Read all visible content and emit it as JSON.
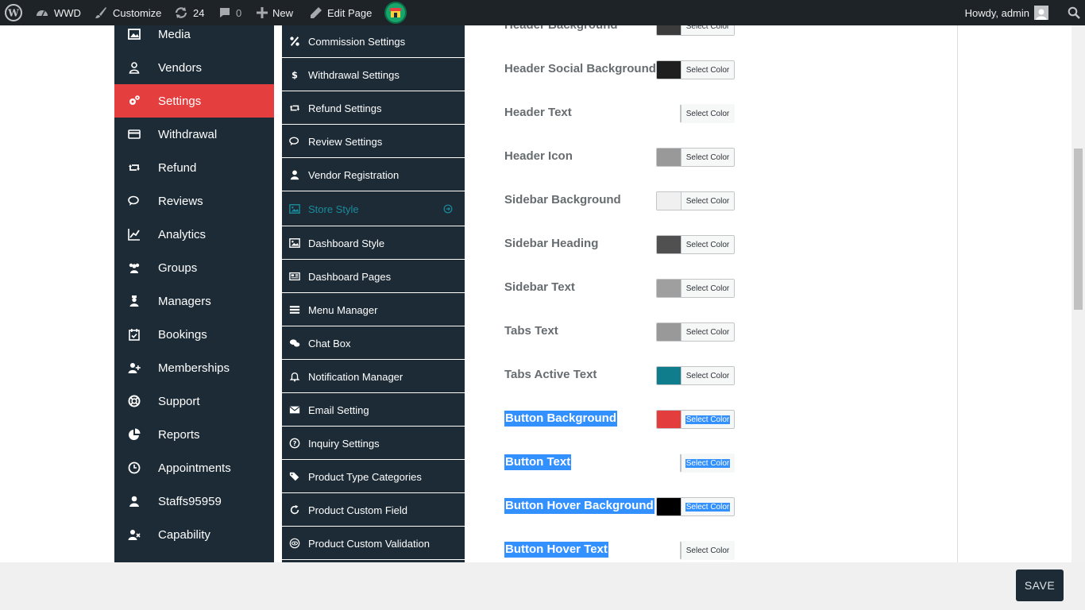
{
  "adminbar": {
    "site_name": "WWD",
    "customize": "Customize",
    "updates_count": "24",
    "comments_count": "0",
    "new_label": "New",
    "edit_page": "Edit Page",
    "howdy": "Howdy, admin"
  },
  "main_menu": [
    {
      "label": "Media",
      "icon": "media-icon"
    },
    {
      "label": "Vendors",
      "icon": "vendor-user-icon"
    },
    {
      "label": "Settings",
      "icon": "cogs-icon",
      "active": true
    },
    {
      "label": "Withdrawal",
      "icon": "credit-card-icon"
    },
    {
      "label": "Refund",
      "icon": "retweet-icon"
    },
    {
      "label": "Reviews",
      "icon": "comments-icon"
    },
    {
      "label": "Analytics",
      "icon": "chart-line-icon"
    },
    {
      "label": "Groups",
      "icon": "users-icon"
    },
    {
      "label": "Managers",
      "icon": "manager-icon"
    },
    {
      "label": "Bookings",
      "icon": "calendar-check-icon"
    },
    {
      "label": "Memberships",
      "icon": "user-plus-icon"
    },
    {
      "label": "Support",
      "icon": "life-ring-icon"
    },
    {
      "label": "Reports",
      "icon": "pie-chart-icon"
    },
    {
      "label": "Appointments",
      "icon": "clock-icon"
    },
    {
      "label": "Staffs95959",
      "icon": "user-icon"
    },
    {
      "label": "Capability",
      "icon": "user-times-icon"
    }
  ],
  "sub_menu": [
    {
      "label": "Commission Settings",
      "icon": "percent-icon"
    },
    {
      "label": "Withdrawal Settings",
      "icon": "dollar-icon"
    },
    {
      "label": "Refund Settings",
      "icon": "retweet-icon"
    },
    {
      "label": "Review Settings",
      "icon": "comments-icon"
    },
    {
      "label": "Vendor Registration",
      "icon": "user-icon"
    },
    {
      "label": "Store Style",
      "icon": "image-icon",
      "current": true
    },
    {
      "label": "Dashboard Style",
      "icon": "image-icon"
    },
    {
      "label": "Dashboard Pages",
      "icon": "newspaper-icon"
    },
    {
      "label": "Menu Manager",
      "icon": "list-icon"
    },
    {
      "label": "Chat Box",
      "icon": "chat-icon"
    },
    {
      "label": "Notification Manager",
      "icon": "bell-icon"
    },
    {
      "label": "Email Setting",
      "icon": "envelope-icon"
    },
    {
      "label": "Inquiry Settings",
      "icon": "question-icon"
    },
    {
      "label": "Product Type Categories",
      "icon": "tags-icon"
    },
    {
      "label": "Product Custom Field",
      "icon": "refresh-icon"
    },
    {
      "label": "Product Custom Validation",
      "icon": "eye-icon"
    }
  ],
  "color_rows": [
    {
      "label": "Header Background",
      "swatch": "#3c3c3c",
      "button": "Select Color",
      "selected": false
    },
    {
      "label": "Header Social Background",
      "swatch": "#1f1f1f",
      "button": "Select Color",
      "selected": false
    },
    {
      "label": "Header Text",
      "swatch": "",
      "button": "Select Color",
      "selected": false
    },
    {
      "label": "Header Icon",
      "swatch": "#999999",
      "button": "Select Color",
      "selected": false
    },
    {
      "label": "Sidebar Background",
      "swatch": "#f0f0f0",
      "button": "Select Color",
      "selected": false
    },
    {
      "label": "Sidebar Heading",
      "swatch": "#505050",
      "button": "Select Color",
      "selected": false
    },
    {
      "label": "Sidebar Text",
      "swatch": "#9f9f9f",
      "button": "Select Color",
      "selected": false
    },
    {
      "label": "Tabs Text",
      "swatch": "#999999",
      "button": "Select Color",
      "selected": false
    },
    {
      "label": "Tabs Active Text",
      "swatch": "#0f7d8c",
      "button": "Select Color",
      "selected": false
    },
    {
      "label": "Button Background",
      "swatch": "#e33d3d",
      "button": "Select Color",
      "selected": true
    },
    {
      "label": "Button Text",
      "swatch": "",
      "button": "Select Color",
      "selected": true
    },
    {
      "label": "Button Hover Background",
      "swatch": "#000000",
      "button": "Select Color",
      "selected": true
    },
    {
      "label": "Button Hover Text",
      "swatch": "",
      "button": "Select Color",
      "selected": true,
      "button_selected": false
    }
  ],
  "footer": {
    "save_label": "SAVE"
  },
  "colors": {
    "menu_bg": "#1c2b36",
    "active": "#e53e3e",
    "accent": "#1a8b9b",
    "selection": "#3390ff"
  }
}
